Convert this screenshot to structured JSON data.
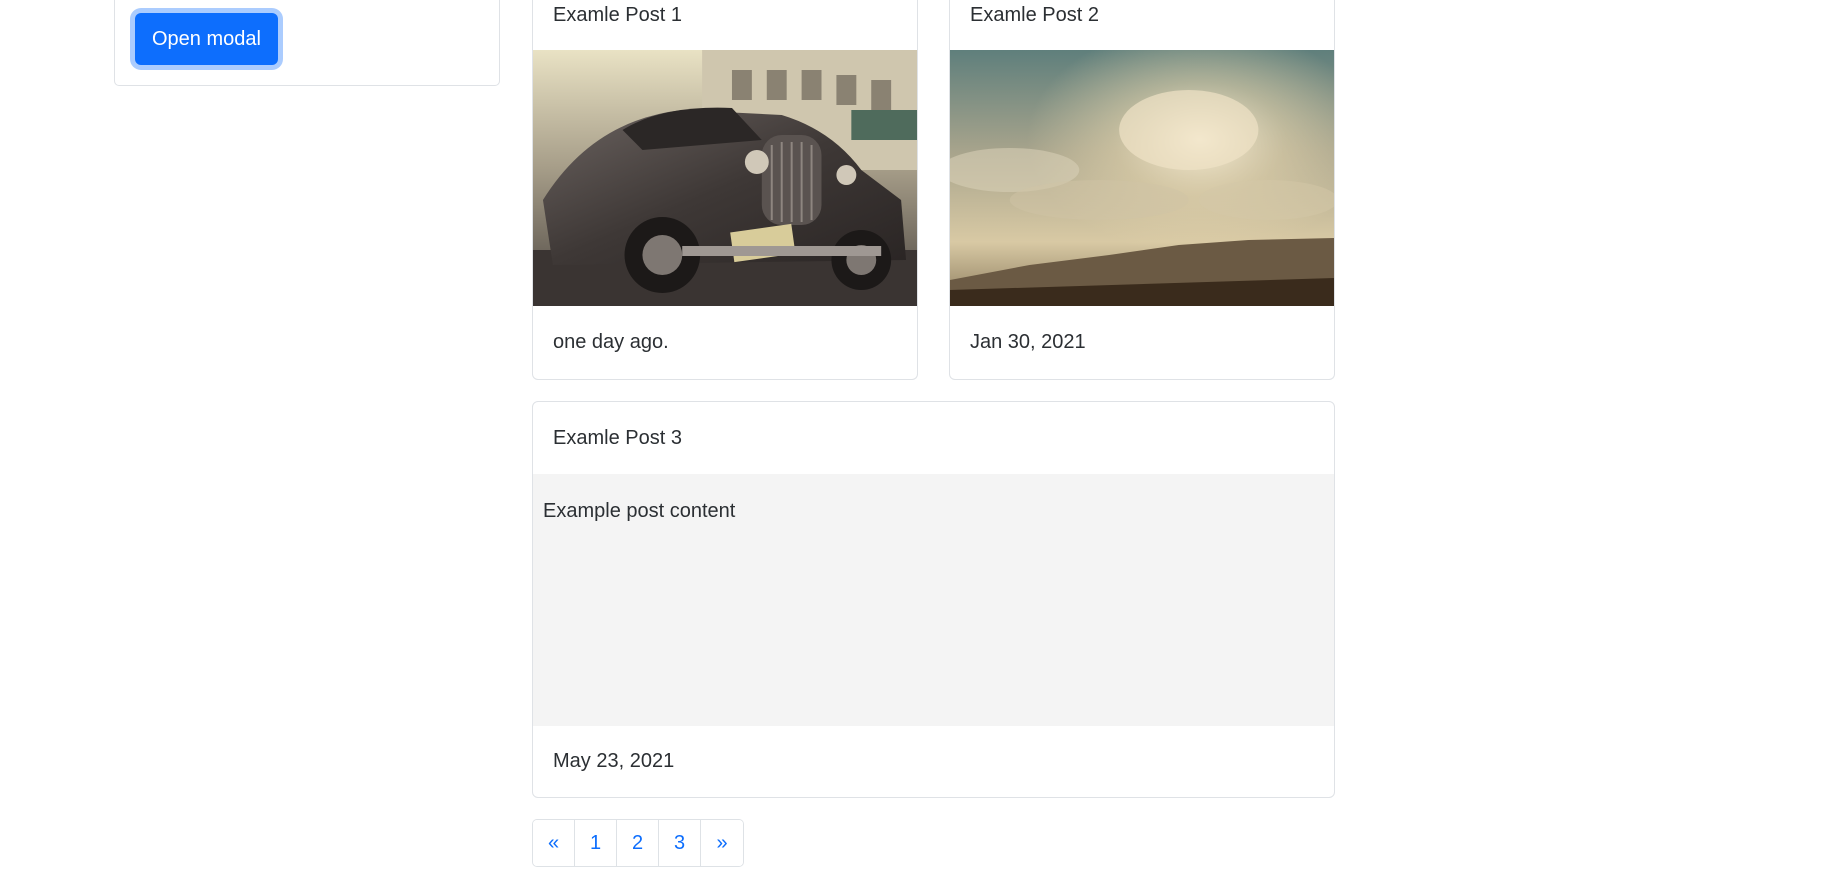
{
  "sidebar": {
    "open_modal_label": "Open modal"
  },
  "posts": [
    {
      "title": "Examle Post 1",
      "footer": "one day ago."
    },
    {
      "title": "Examle Post 2",
      "footer": "Jan 30, 2021"
    },
    {
      "title": "Examle Post 3",
      "content": "Example post content",
      "footer": "May 23, 2021"
    }
  ],
  "pagination": {
    "prev": "«",
    "pages": [
      "1",
      "2",
      "3"
    ],
    "next": "»"
  },
  "colors": {
    "primary": "#0d6efd",
    "border": "#dfe2e6",
    "content_bg": "#f4f4f4"
  }
}
